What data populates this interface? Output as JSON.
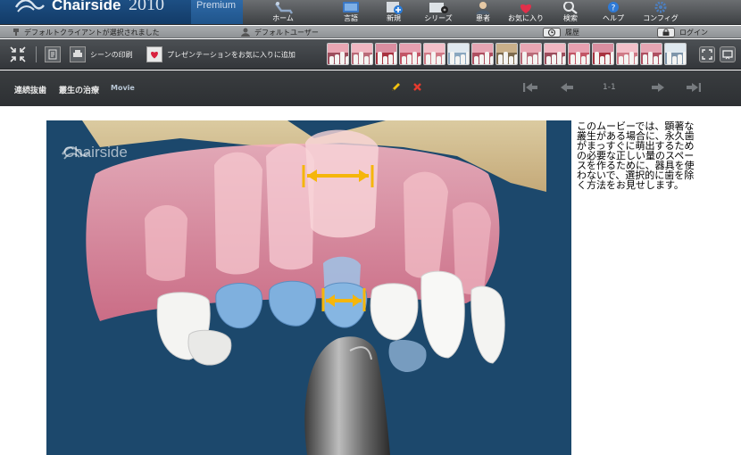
{
  "app": {
    "name": "Chairside",
    "year": "2010",
    "edition": "Premium"
  },
  "nav": {
    "home": "ホーム",
    "glossary": "言語",
    "new": "新規",
    "series": "シリーズ",
    "patients": "患者",
    "favorites": "お気に入り",
    "search": "検索",
    "help": "ヘルプ",
    "config": "コンフィグ"
  },
  "status": {
    "client": "デフォルトクライアントが選択されました",
    "user": "デフォルトユーザー",
    "history": "履歴",
    "login": "ログイン"
  },
  "toolbar": {
    "print_scene": "シーンの印刷",
    "add_to_favorites": "プレゼンテーションをお気に入りに追加"
  },
  "title": {
    "category": "連続抜歯",
    "topic": "叢生の治療",
    "type": "Movie",
    "page": "1-1"
  },
  "video": {
    "watermark": "Chairside"
  },
  "description": "このムービーでは、顕著な叢生がある場合に、永久歯がまっすぐに萌出するための必要な正しい量のスペースを作るために、器具を使わないで、選択的に歯を除く方法をお見せします。",
  "colors": {
    "brand_blue": "#1d4f84",
    "toolbar_dark": "#3d4043",
    "video_bg": "#1c486c",
    "gum_pink": "#e88ea0",
    "highlight_blue": "#7fb0de",
    "marker_yellow": "#f5b60b",
    "edit_yellow": "#f2c20f",
    "delete_red": "#e63a2e"
  },
  "icons": {
    "logo": "chairside-wave-icon",
    "home": "dental-chair-icon",
    "glossary": "book-icon",
    "new": "new-document-icon",
    "series": "film-reel-icon",
    "patients": "patient-icon",
    "favorites": "heart-icon",
    "search": "magnifier-icon",
    "help": "question-icon",
    "config": "gear-icon",
    "client": "pin-icon",
    "user": "person-icon",
    "history": "clock-icon",
    "login": "lock-icon",
    "collapse": "collapse-icon",
    "slides": "slides-icon",
    "print": "printer-icon",
    "favorite_add": "heart-add-icon",
    "edit": "pencil-icon",
    "delete": "cross-icon",
    "first": "first-page-icon",
    "prev": "previous-icon",
    "next": "next-icon",
    "last": "last-page-icon",
    "fullscreen": "expand-icon",
    "present": "presentation-icon"
  }
}
